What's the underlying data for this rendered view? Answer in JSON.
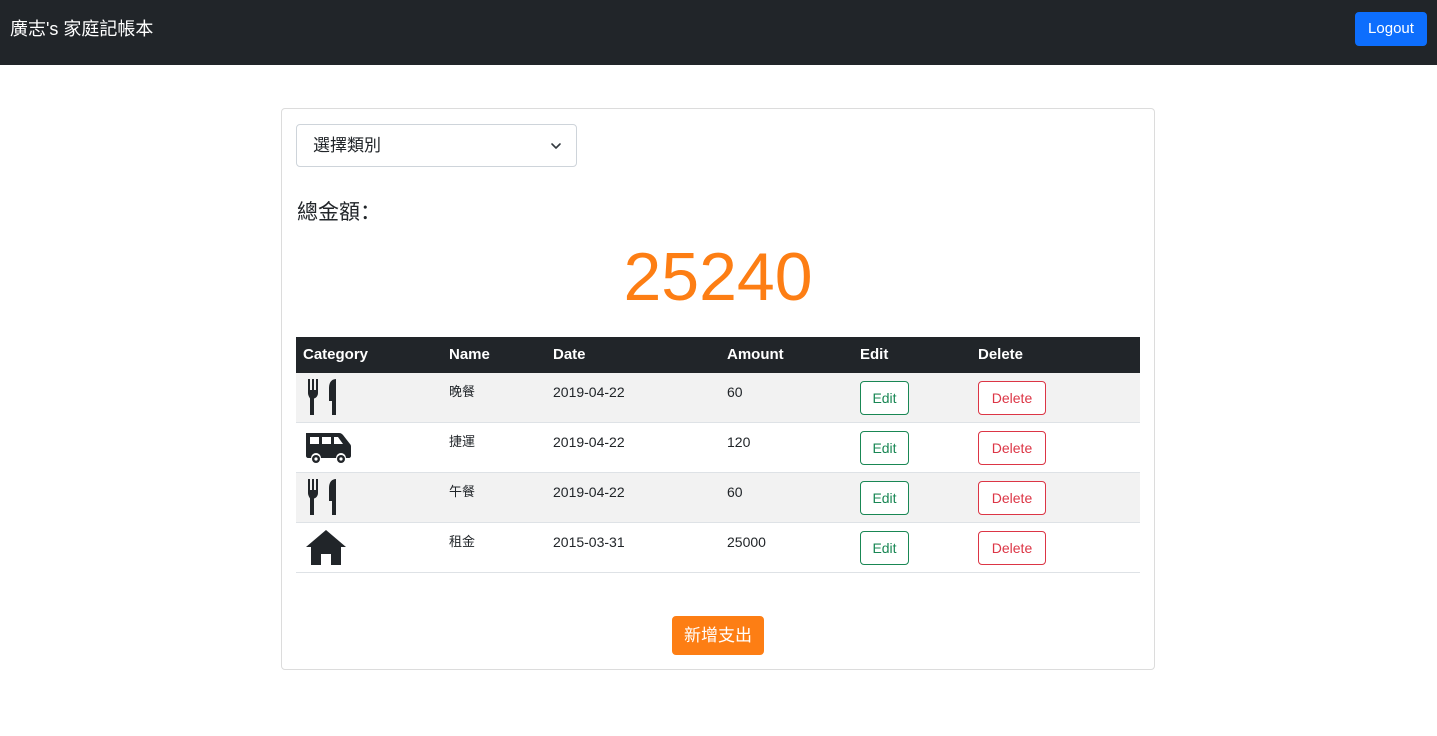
{
  "navbar": {
    "brand": "廣志's 家庭記帳本",
    "logout_label": "Logout"
  },
  "filter": {
    "selected": "選擇類別"
  },
  "summary": {
    "label": "總金額：",
    "total": "25240"
  },
  "table": {
    "headers": [
      "Category",
      "Name",
      "Date",
      "Amount",
      "Edit",
      "Delete"
    ],
    "rows": [
      {
        "icon": "utensils-icon",
        "name": "晚餐",
        "date": "2019-04-22",
        "amount": "60",
        "edit": "Edit",
        "delete": "Delete"
      },
      {
        "icon": "shuttle-van-icon",
        "name": "捷運",
        "date": "2019-04-22",
        "amount": "120",
        "edit": "Edit",
        "delete": "Delete"
      },
      {
        "icon": "utensils-icon",
        "name": "午餐",
        "date": "2019-04-22",
        "amount": "60",
        "edit": "Edit",
        "delete": "Delete"
      },
      {
        "icon": "home-icon",
        "name": "租金",
        "date": "2015-03-31",
        "amount": "25000",
        "edit": "Edit",
        "delete": "Delete"
      }
    ]
  },
  "add_button_label": "新增支出",
  "colors": {
    "navbar": "#212529",
    "primary": "#0d6efd",
    "accent": "#fd7e14",
    "success": "#198754",
    "danger": "#dc3545"
  }
}
